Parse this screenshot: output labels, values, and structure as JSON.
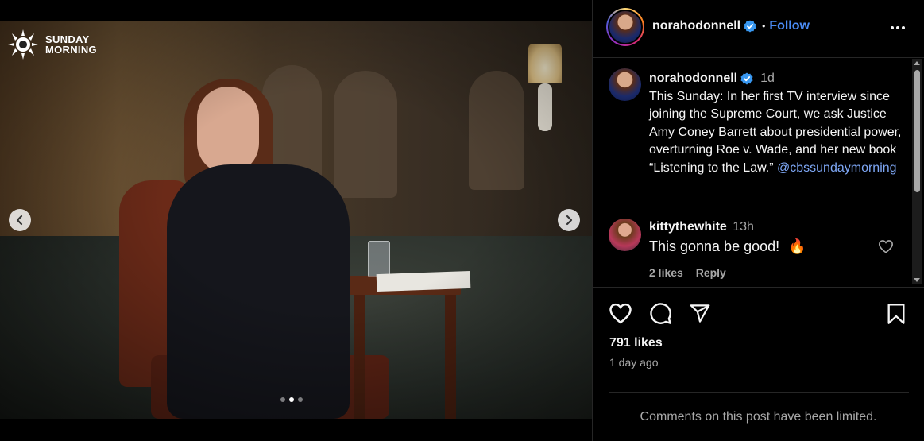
{
  "media": {
    "logo_line1": "SUNDAY",
    "logo_line2": "MORNING",
    "carousel_active_index": 2,
    "carousel_count": 3
  },
  "header": {
    "username": "norahodonnell",
    "separator": "•",
    "follow_label": "Follow"
  },
  "caption": {
    "username": "norahodonnell",
    "time": "1d",
    "text": "This Sunday: In her first TV interview since joining the Supreme Court, we ask Justice Amy Coney Barrett about presidential power, overturning Roe v. Wade, and her new book “Listening to the Law.”",
    "mention": "@cbssundaymorning"
  },
  "comment": {
    "username": "kittythewhite",
    "time": "13h",
    "text": "This gonna be good!",
    "emoji": "🔥",
    "likes": "2 likes",
    "reply_label": "Reply"
  },
  "stats": {
    "likes": "791 likes",
    "date": "1 day ago"
  },
  "footer": {
    "limited_text": "Comments on this post have been limited."
  },
  "colors": {
    "accent": "#4a8bf5",
    "mention": "#7ea7f5",
    "muted": "#a8a8a8",
    "background": "#000000"
  },
  "icons": [
    "sunday-morning-logo-icon",
    "chevron-left-icon",
    "chevron-right-icon",
    "verified-icon",
    "more-icon",
    "heart-icon",
    "comment-icon",
    "share-icon",
    "bookmark-icon",
    "fire-icon"
  ]
}
